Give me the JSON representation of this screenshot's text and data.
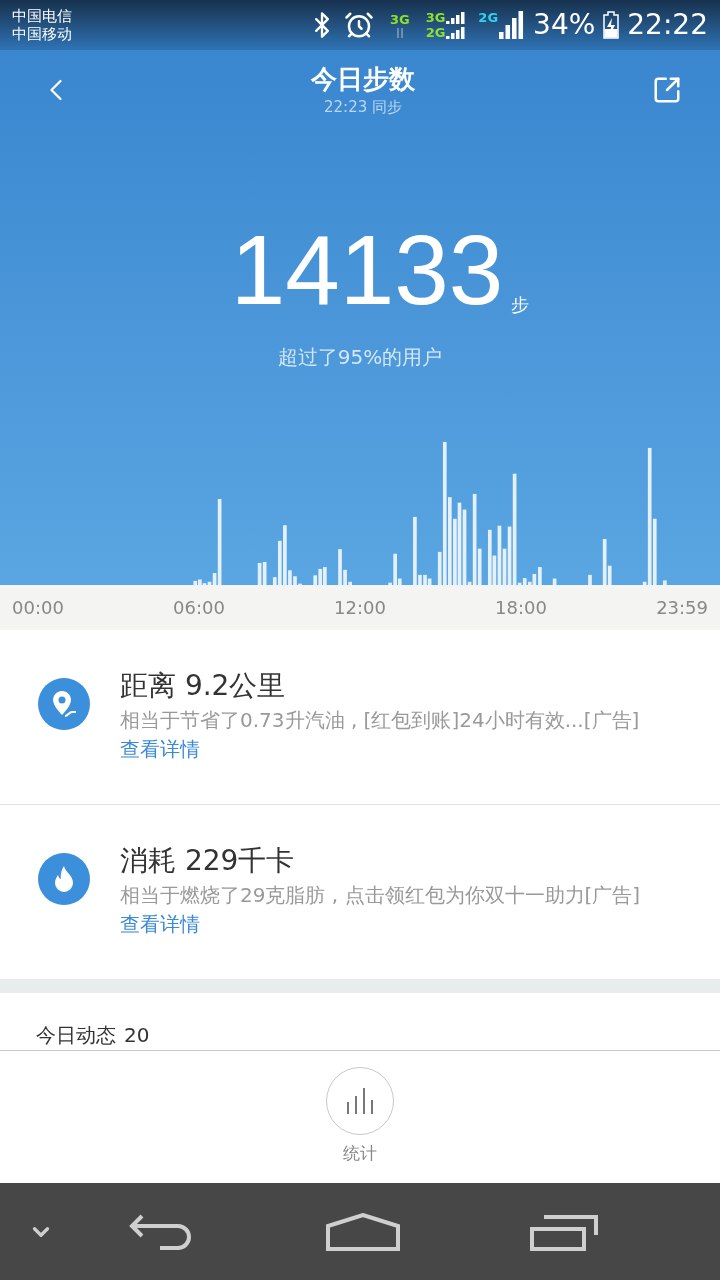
{
  "status_bar": {
    "carriers": [
      "中国电信",
      "中国移动"
    ],
    "networks": [
      {
        "label": "3G",
        "color": "#8fe02b",
        "kind": "data"
      },
      {
        "label": "3G",
        "color": "#8fe02b",
        "kind": "small"
      },
      {
        "label": "2G",
        "color": "#8fe02b",
        "kind": "small"
      },
      {
        "label": "2G",
        "color": "#2fd3f0",
        "kind": "large"
      }
    ],
    "battery": "34%",
    "time": "22:22"
  },
  "header": {
    "title": "今日步数",
    "subtitle": "22:23 同步"
  },
  "steps": {
    "count": "14133",
    "unit": "步",
    "caption": "超过了95%的用户"
  },
  "timeline_labels": [
    "00:00",
    "06:00",
    "12:00",
    "18:00",
    "23:59"
  ],
  "metrics": [
    {
      "kind": "distance",
      "title": "距离 9.2公里",
      "description": "相当于节省了0.73升汽油 , [红包到账]24小时有效...[广告]",
      "link": "查看详情"
    },
    {
      "kind": "calories",
      "title": "消耗 229千卡",
      "description": "相当于燃烧了29克脂肪 , 点击领红包为你双十一助力[广告]",
      "link": "查看详情"
    }
  ],
  "section": {
    "title": "今日动态",
    "count": "20"
  },
  "footer": {
    "button_label": "统计"
  }
}
